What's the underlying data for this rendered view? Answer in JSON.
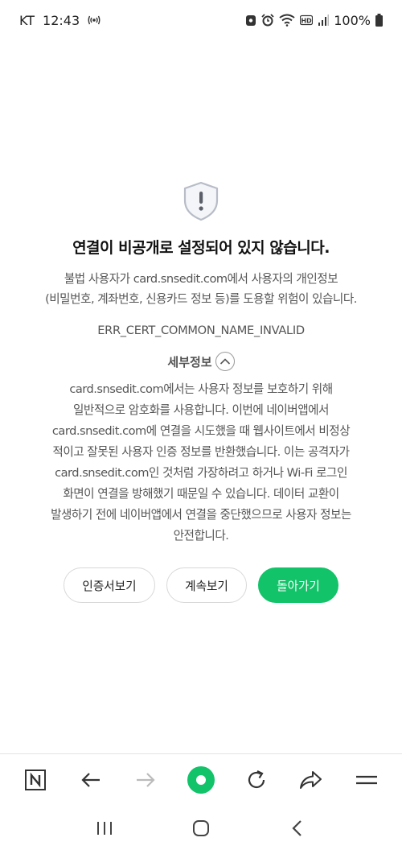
{
  "status_bar": {
    "carrier": "KT",
    "time": "12:43",
    "battery": "100%"
  },
  "error": {
    "title": "연결이 비공개로 설정되어 있지 않습니다.",
    "description_line1": "불법 사용자가 card.snsedit.com에서 사용자의 개인정보",
    "description_line2": "(비밀번호, 계좌번호, 신용카드 정보 등)를 도용할 위험이 있습니다.",
    "code": "ERR_CERT_COMMON_NAME_INVALID",
    "details_label": "세부정보",
    "details_lines": [
      "card.snsedit.com에서는 사용자 정보를 보호하기 위해",
      "일반적으로 암호화를 사용합니다. 이번에 네이버앱에서",
      "card.snsedit.com에 연결을 시도했을 때 웹사이트에서 비정상",
      "적이고 잘못된 사용자 인증 정보를 반환했습니다. 이는 공격자가",
      "card.snsedit.com인 것처럼 가장하려고 하거나 Wi-Fi 로그인",
      "화면이 연결을 방해했기 때문일 수 있습니다. 데이터 교환이",
      "발생하기 전에 네이버앱에서 연결을 중단했으므로 사용자 정보는",
      "안전합니다."
    ]
  },
  "buttons": {
    "view_certificate": "인증서보기",
    "continue": "계속보기",
    "go_back": "돌아가기"
  },
  "colors": {
    "primary": "#12c369",
    "text": "#555555",
    "title": "#111111"
  },
  "toolbar_icons": [
    "naver-home-icon",
    "back-arrow-icon",
    "forward-arrow-icon",
    "green-dot-icon",
    "refresh-icon",
    "share-icon",
    "menu-icon"
  ],
  "nav_icons": [
    "recent-apps-icon",
    "home-icon",
    "back-icon"
  ]
}
